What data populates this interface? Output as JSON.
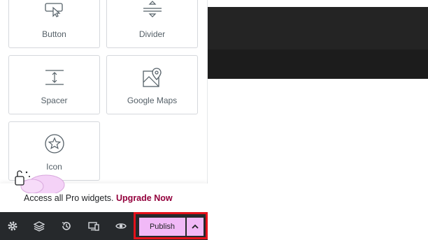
{
  "widgets": {
    "button": {
      "label": "Button",
      "icon": "button-cursor-icon"
    },
    "divider": {
      "label": "Divider",
      "icon": "divider-icon"
    },
    "spacer": {
      "label": "Spacer",
      "icon": "spacer-icon"
    },
    "google_maps": {
      "label": "Google Maps",
      "icon": "map-pin-icon"
    },
    "icon": {
      "label": "Icon",
      "icon": "star-icon"
    }
  },
  "promo": {
    "text": "Access all Pro widgets.",
    "link": "Upgrade Now",
    "link_color": "#93003c",
    "art_icon": "lock-icon"
  },
  "toolbar": {
    "icons": [
      "settings-icon",
      "layers-icon",
      "history-icon",
      "responsive-icon",
      "preview-eye-icon"
    ],
    "publish_label": "Publish",
    "publish_color": "#f1b9f7",
    "highlight_color": "#e4111b"
  }
}
